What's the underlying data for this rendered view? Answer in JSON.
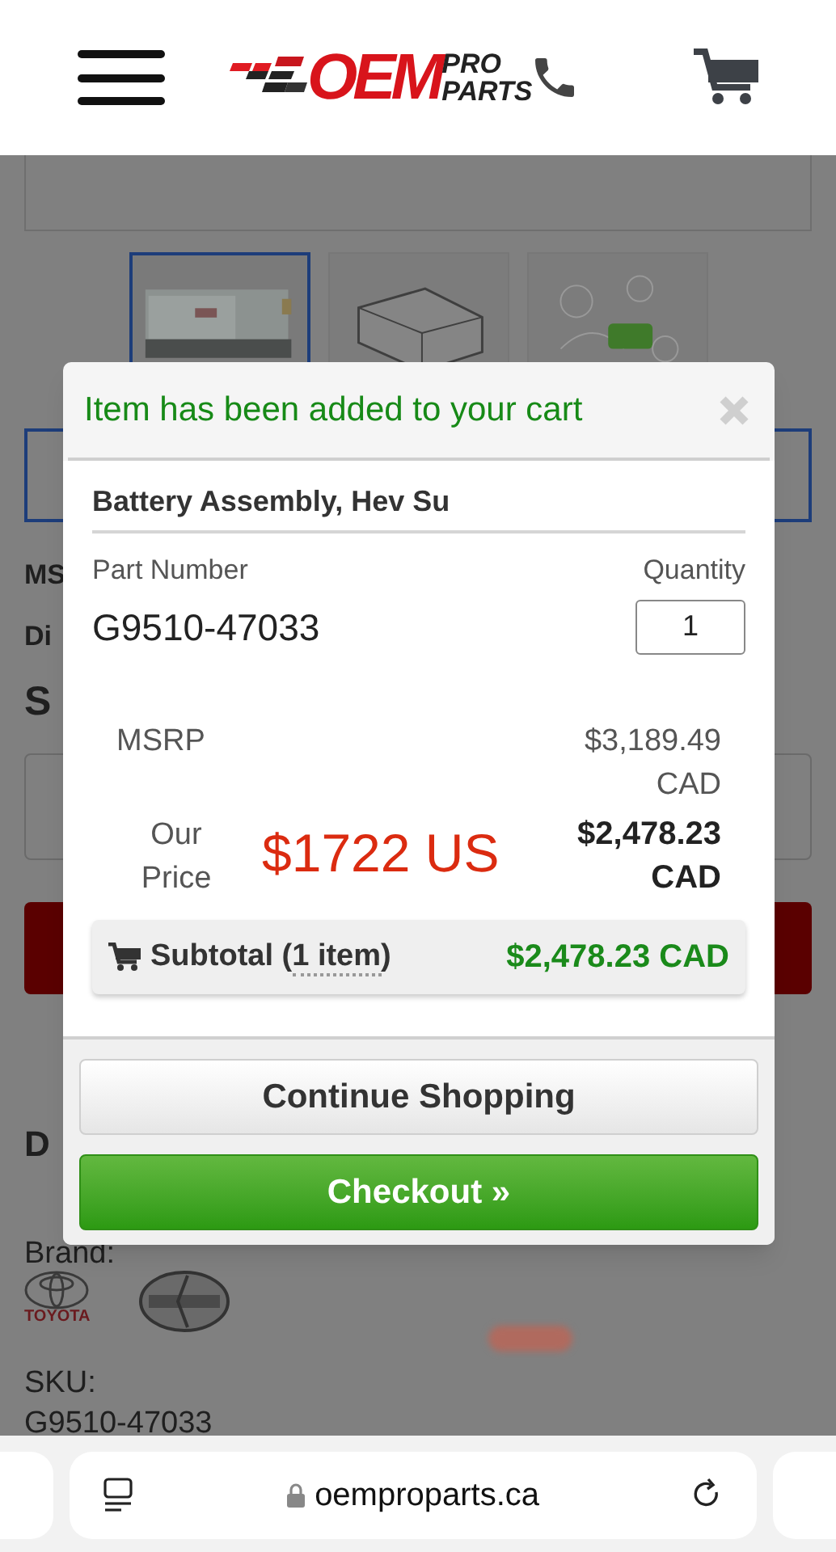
{
  "header": {
    "logo": {
      "main": "OEM",
      "top": "PRO",
      "bottom": "PARTS"
    }
  },
  "thumbnails": [
    {
      "kind": "picture",
      "selected": true
    },
    {
      "kind": "picture",
      "selected": false
    },
    {
      "kind": "picture",
      "selected": false
    }
  ],
  "page": {
    "msrp_label": "MS",
    "discount_label": "Di",
    "sale_label": "S",
    "description_heading": "D",
    "brand_label": "Brand:",
    "brand_logo_text": "TOYOTA",
    "sku_label": "SKU:",
    "sku_value": "G9510-47033"
  },
  "modal": {
    "title": "Item has been added to your cart",
    "product_name": "Battery Assembly, Hev Su",
    "part_number_label": "Part Number",
    "part_number": "G9510-47033",
    "quantity_label": "Quantity",
    "quantity": "1",
    "msrp_label": "MSRP",
    "msrp_value": "$3,189.49",
    "msrp_currency": "CAD",
    "our_price_label_1": "Our",
    "our_price_label_2": "Price",
    "usd_price": "$1722 US",
    "our_price_value": "$2,478.23",
    "our_price_currency": "CAD",
    "subtotal": {
      "label_before": "Subtotal (",
      "count": "1 item",
      "label_after": ")",
      "value": "$2,478.23 CAD"
    },
    "buttons": [
      {
        "kind": "secondary",
        "label": "Continue Shopping"
      },
      {
        "kind": "primary",
        "label": "Checkout »"
      }
    ]
  },
  "browser": {
    "url": "oemproparts.ca"
  }
}
